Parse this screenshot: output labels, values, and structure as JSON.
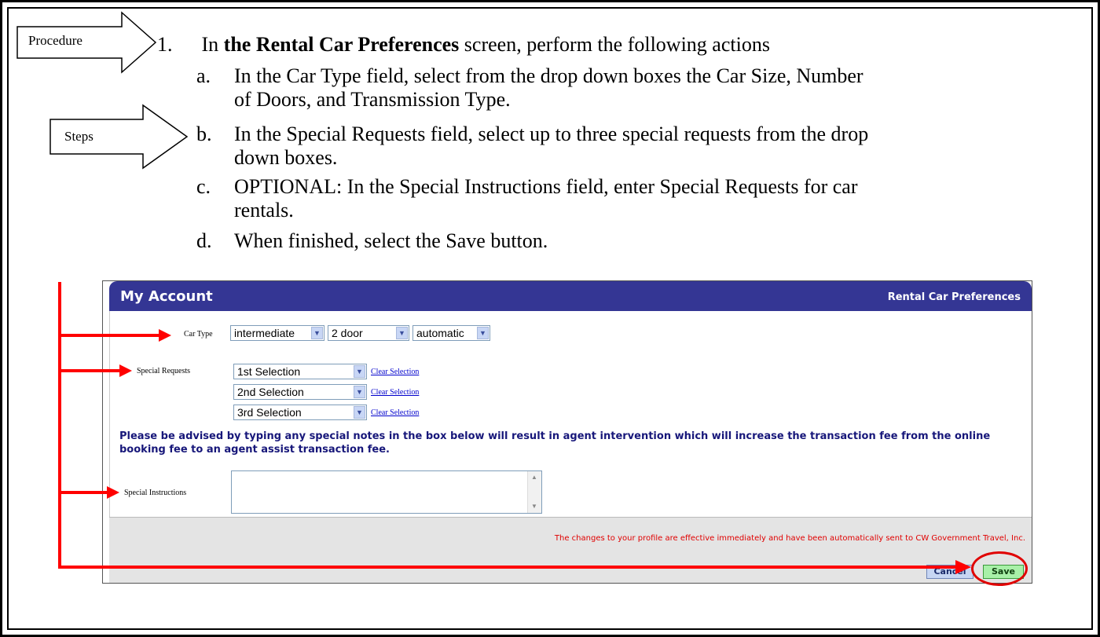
{
  "callouts": {
    "procedure": "Procedure",
    "steps": "Steps"
  },
  "instructions": {
    "step1_number": "1.",
    "step1_pre": "In ",
    "step1_bold": "the Rental Car Preferences",
    "step1_post": " screen, perform the following actions",
    "substeps": [
      {
        "letter": "a.",
        "text": "In the Car Type field, select from the drop down boxes the Car Size, Number of Doors, and Transmission Type."
      },
      {
        "letter": "b.",
        "text": "In the Special Requests field, select up to three special requests from the drop down boxes."
      },
      {
        "letter": "c.",
        "text": "OPTIONAL:  In the Special Instructions field, enter Special Requests for car rentals."
      },
      {
        "letter": "d.",
        "text": "When finished, select the Save button."
      }
    ]
  },
  "screenshot": {
    "title": "My Account",
    "subtitle": "Rental Car Preferences",
    "car_type": {
      "label": "Car Type",
      "size": "intermediate",
      "doors": "2 door",
      "transmission": "automatic"
    },
    "special_requests": {
      "label": "Special Requests",
      "selections": [
        "1st Selection",
        "2nd Selection",
        "3rd Selection"
      ],
      "clear_label": "Clear Selection"
    },
    "notice": "Please be advised by typing any special notes in the box below will result in agent intervention which will increase the transaction fee from the online booking fee to an agent assist transaction fee.",
    "special_instructions": {
      "label": "Special Instructions",
      "value": ""
    },
    "footer_message": "The changes to your profile are effective immediately and have been automatically sent to CW Government Travel, Inc.",
    "cancel_label": "Cancel",
    "save_label": "Save"
  },
  "colors": {
    "header": "#343694",
    "annotation": "#ff0000",
    "notice": "#17177a"
  }
}
